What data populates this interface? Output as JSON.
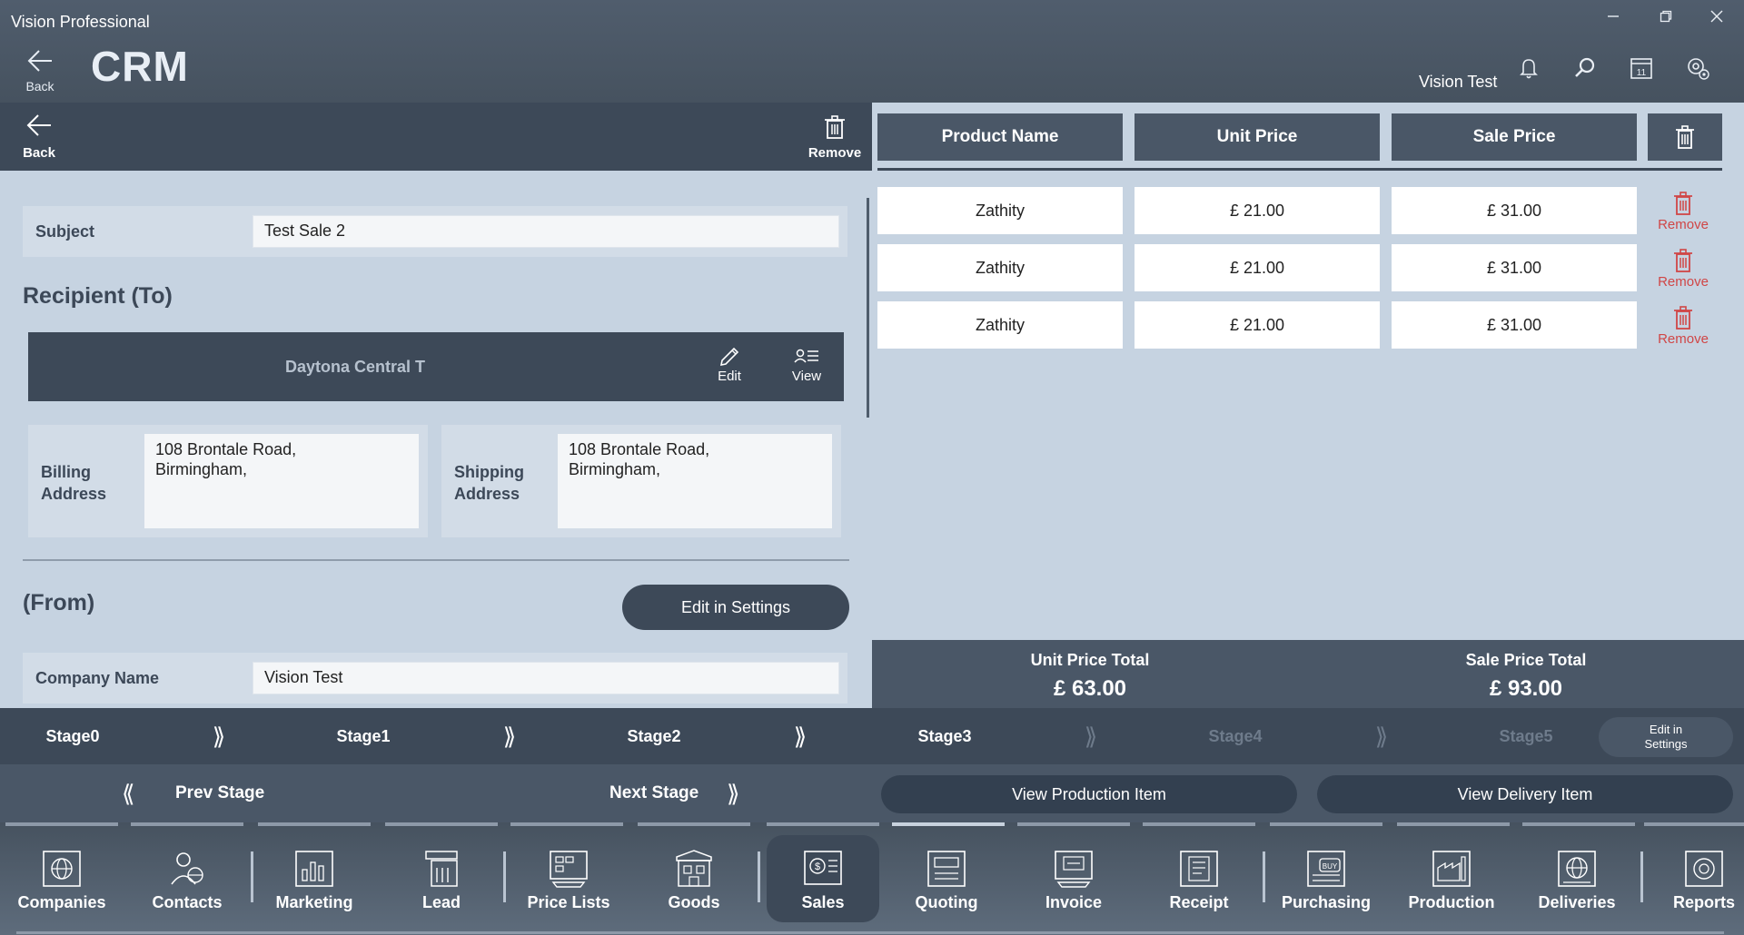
{
  "app_title": "Vision Professional",
  "header": {
    "back_label": "Back",
    "module_title": "CRM",
    "user_name": "Vision Test",
    "icons": [
      "bell-icon",
      "search-icon",
      "calendar-icon",
      "settings-icon"
    ],
    "calendar_day": "11"
  },
  "toolbar": {
    "back_label": "Back",
    "remove_label": "Remove"
  },
  "form": {
    "subject_label": "Subject",
    "subject_value": "Test Sale 2",
    "recipient_title": "Recipient (To)",
    "recipient_name": "Daytona Central T",
    "edit_label": "Edit",
    "view_label": "View",
    "billing_label": "Billing Address",
    "billing_value": "108 Brontale Road,\nBirmingham,",
    "shipping_label": "Shipping Address",
    "shipping_value": "108 Brontale Road,\nBirmingham,",
    "from_title": "(From)",
    "edit_settings_label": "Edit in Settings",
    "company_name_label": "Company Name",
    "company_name_value": "Vision Test"
  },
  "table": {
    "headers": [
      "Product Name",
      "Unit Price",
      "Sale Price"
    ],
    "rows": [
      {
        "product": "Zathity",
        "unit_price": "£ 21.00",
        "sale_price": "£ 31.00",
        "remove": "Remove"
      },
      {
        "product": "Zathity",
        "unit_price": "£ 21.00",
        "sale_price": "£ 31.00",
        "remove": "Remove"
      },
      {
        "product": "Zathity",
        "unit_price": "£ 21.00",
        "sale_price": "£ 31.00",
        "remove": "Remove"
      }
    ],
    "unit_total_label": "Unit Price Total",
    "unit_total_value": "£ 63.00",
    "sale_total_label": "Sale Price Total",
    "sale_total_value": "£ 93.00"
  },
  "stages": {
    "items": [
      "Stage0",
      "Stage1",
      "Stage2",
      "Stage3",
      "Stage4",
      "Stage5"
    ],
    "active_count": 4,
    "settings_label_1": "Edit in",
    "settings_label_2": "Settings"
  },
  "nav": {
    "prev_label": "Prev Stage",
    "next_label": "Next Stage",
    "view_production": "View Production Item",
    "view_delivery": "View Delivery Item"
  },
  "modules": {
    "items": [
      "Companies",
      "Contacts",
      "Marketing",
      "Lead",
      "Price Lists",
      "Goods",
      "Sales",
      "Quoting",
      "Invoice",
      "Receipt",
      "Purchasing",
      "Production",
      "Deliveries",
      "Reports"
    ],
    "active": "Sales"
  },
  "colors": {
    "header_bg": "#4b5766",
    "panel_bg": "#c6d3e1",
    "dark": "#3d4958",
    "remove_red": "#d04646"
  }
}
